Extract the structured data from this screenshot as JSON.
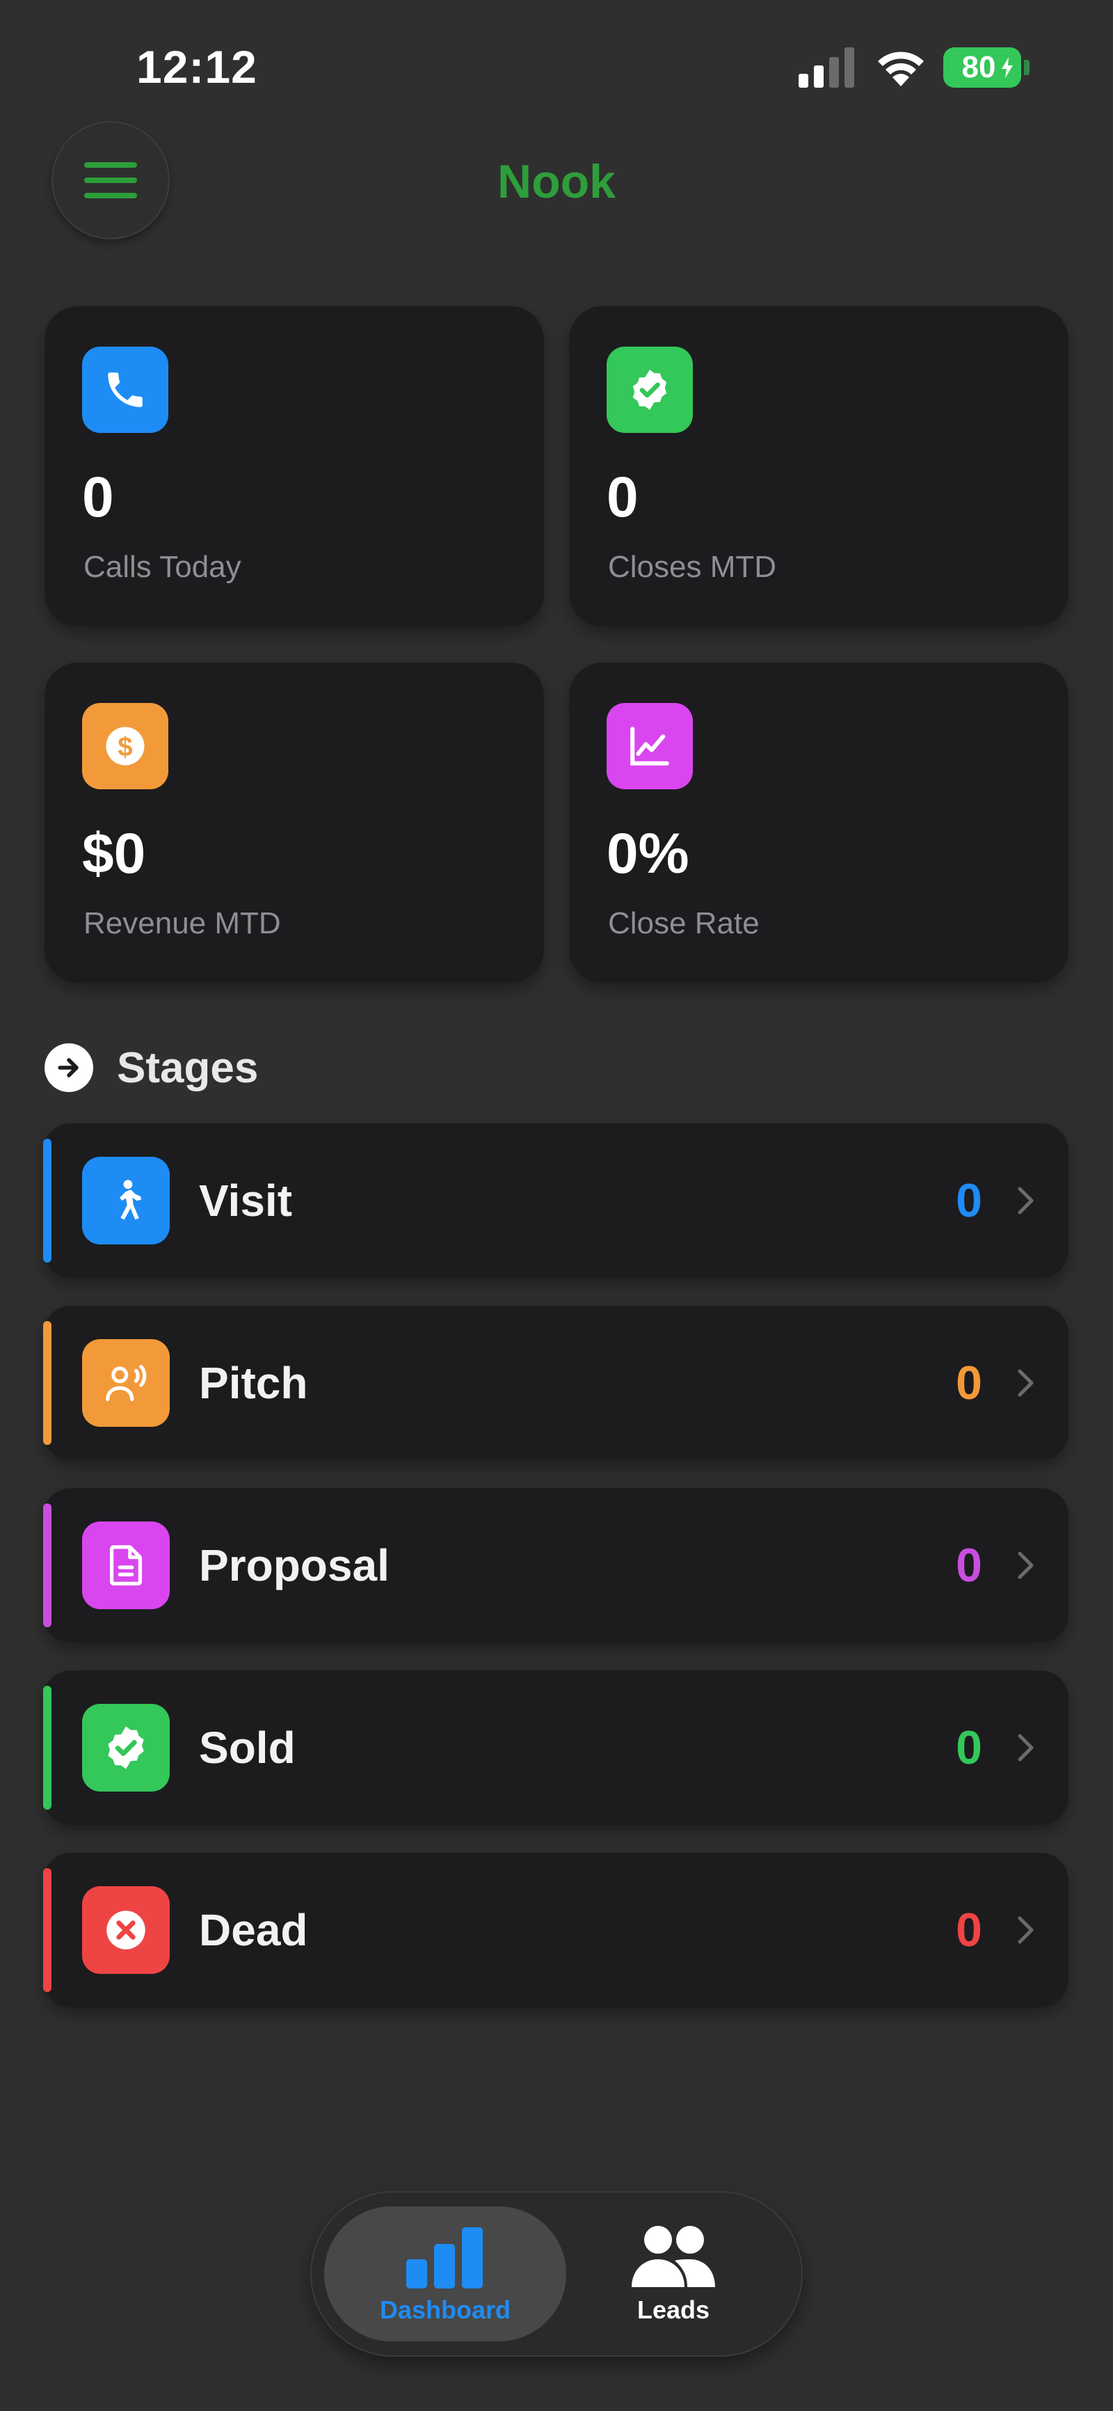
{
  "status_bar": {
    "time": "12:12",
    "battery": "80",
    "icons": [
      "signal-icon",
      "wifi-icon",
      "battery-icon"
    ]
  },
  "header": {
    "title": "Nook",
    "menu_icon": "hamburger-icon",
    "title_color": "#2e9e3b"
  },
  "stats": [
    {
      "value": "0",
      "label": "Calls Today",
      "icon": "phone-icon",
      "color": "#1e8cf5"
    },
    {
      "value": "0",
      "label": "Closes MTD",
      "icon": "check-seal-icon",
      "color": "#34c759"
    },
    {
      "value": "$0",
      "label": "Revenue MTD",
      "icon": "dollar-icon",
      "color": "#f29a3a"
    },
    {
      "value": "0%",
      "label": "Close Rate",
      "icon": "chart-line-icon",
      "color": "#d946ef"
    }
  ],
  "stages_section": {
    "title": "Stages",
    "icon": "arrow-right-circle-icon"
  },
  "stages": [
    {
      "label": "Visit",
      "count": "0",
      "icon": "walking-person-icon",
      "color": "#1e8cf5"
    },
    {
      "label": "Pitch",
      "count": "0",
      "icon": "person-speaking-icon",
      "color": "#f29a3a"
    },
    {
      "label": "Proposal",
      "count": "0",
      "icon": "document-icon",
      "color": "#c94ee0"
    },
    {
      "label": "Sold",
      "count": "0",
      "icon": "check-seal-icon",
      "color": "#34c759"
    },
    {
      "label": "Dead",
      "count": "0",
      "icon": "x-circle-icon",
      "color": "#ef4444"
    }
  ],
  "tab_bar": {
    "tabs": [
      {
        "label": "Dashboard",
        "icon": "bar-chart-icon",
        "active": true,
        "color": "#1e8cf5"
      },
      {
        "label": "Leads",
        "icon": "people-icon",
        "active": false,
        "color": "#ffffff"
      }
    ]
  }
}
